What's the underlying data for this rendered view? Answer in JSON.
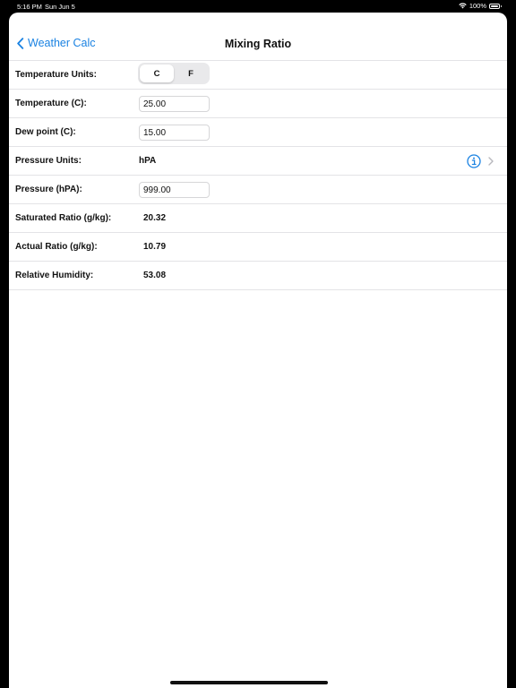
{
  "status_bar": {
    "time": "5:16 PM",
    "date": "Sun Jun 5",
    "battery": "100%"
  },
  "nav": {
    "back_label": "Weather Calc",
    "title": "Mixing Ratio"
  },
  "rows": {
    "temperature_units": {
      "label": "Temperature Units:",
      "options": [
        "C",
        "F"
      ],
      "selected": "C"
    },
    "temperature": {
      "label": "Temperature (C):",
      "value": "25.00"
    },
    "dew_point": {
      "label": "Dew point (C):",
      "value": "15.00"
    },
    "pressure_units": {
      "label": "Pressure Units:",
      "value": "hPA"
    },
    "pressure": {
      "label": "Pressure (hPA):",
      "value": "999.00"
    },
    "saturated_ratio": {
      "label": "Saturated Ratio (g/kg):",
      "value": "20.32"
    },
    "actual_ratio": {
      "label": "Actual Ratio (g/kg):",
      "value": "10.79"
    },
    "relative_humidity": {
      "label": "Relative Humidity:",
      "value": "53.08"
    }
  },
  "icons": {
    "back": "chevron-left-icon",
    "info": "info-icon",
    "disclosure": "chevron-right-icon"
  },
  "colors": {
    "accent": "#1a82e2",
    "separator": "#e3e3e6",
    "background": "#000000",
    "sheet": "#ffffff"
  }
}
